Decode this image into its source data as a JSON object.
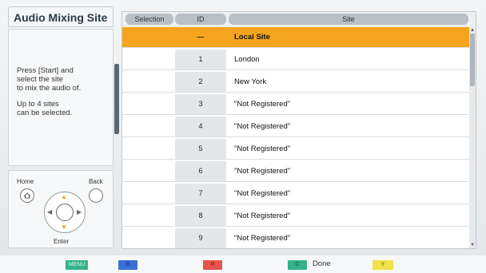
{
  "left_panel": {
    "title": "Audio Mixing Site",
    "instruction_1": "Press [Start] and\nselect the site\nto mix the audio of.",
    "instruction_2": "Up to 4 sites\ncan be selected."
  },
  "remote": {
    "home_label": "Home",
    "back_label": "Back",
    "enter_label": "Enter"
  },
  "table": {
    "columns": [
      "Selection",
      "ID",
      "Site"
    ],
    "rows": [
      {
        "selection": "",
        "id": "—",
        "site": "Local Site"
      },
      {
        "selection": "",
        "id": "1",
        "site": "London"
      },
      {
        "selection": "",
        "id": "2",
        "site": "New York"
      },
      {
        "selection": "",
        "id": "3",
        "site": "\"Not Registered\""
      },
      {
        "selection": "",
        "id": "4",
        "site": "\"Not Registered\""
      },
      {
        "selection": "",
        "id": "5",
        "site": "\"Not Registered\""
      },
      {
        "selection": "",
        "id": "6",
        "site": "\"Not Registered\""
      },
      {
        "selection": "",
        "id": "7",
        "site": "\"Not Registered\""
      },
      {
        "selection": "",
        "id": "8",
        "site": "\"Not Registered\""
      },
      {
        "selection": "",
        "id": "9",
        "site": "\"Not Registered\""
      }
    ],
    "selected_row_color": "#f4a51d"
  },
  "bottom_bar": {
    "menu_key": "MENU",
    "b_key": "B",
    "r_key": "R",
    "g_key": "G",
    "g_label": "Done",
    "y_key": "Y",
    "colors": {
      "menu": "#33b38a",
      "b": "#3a6fd8",
      "r": "#e5534b",
      "g": "#33b38a",
      "y": "#f2e14c"
    }
  }
}
